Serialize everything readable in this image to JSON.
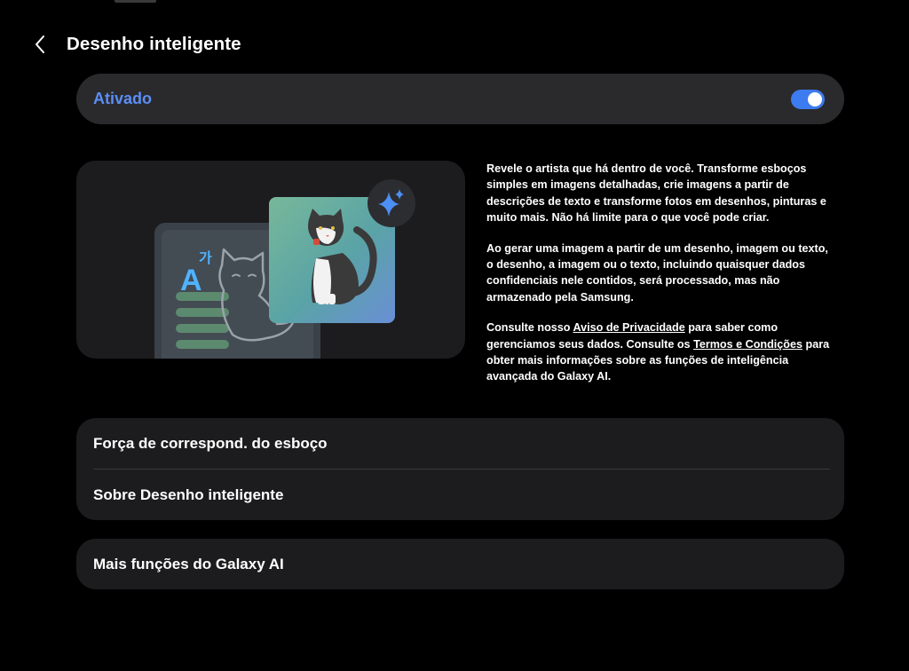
{
  "header": {
    "title": "Desenho inteligente",
    "back_icon": "chevron-left-icon"
  },
  "toggle": {
    "label": "Ativado",
    "state": true,
    "accent_color": "#3d7bf0",
    "label_color": "#5b8ef7"
  },
  "illustration": {
    "badge_icon": "sparkle-icon",
    "glyph_latin": "A",
    "glyph_korean": "가"
  },
  "description": {
    "paragraph1": "Revele o artista que há dentro de você. Transforme esboços simples em imagens detalhadas, crie imagens a partir de descrições de texto e transforme fotos em desenhos, pinturas e muito mais. Não há limite para o que você pode criar.",
    "paragraph2": "Ao gerar uma imagem a partir de um desenho, imagem ou texto, o desenho, a imagem ou o texto, incluindo quaisquer dados confidenciais nele contidos, será processado, mas não armazenado pela Samsung.",
    "paragraph3_part1": "Consulte nosso ",
    "privacy_link": "Aviso de Privacidade",
    "paragraph3_part2": " para saber como gerenciamos seus dados. Consulte os ",
    "terms_link": "Termos e Condições",
    "paragraph3_part3": " para obter mais informações sobre as funções de inteligência avançada do Galaxy AI."
  },
  "settings": {
    "items": [
      {
        "label": "Força de correspond. do esboço"
      },
      {
        "label": "Sobre Desenho inteligente"
      }
    ]
  },
  "more": {
    "label": "Mais funções do Galaxy AI"
  }
}
